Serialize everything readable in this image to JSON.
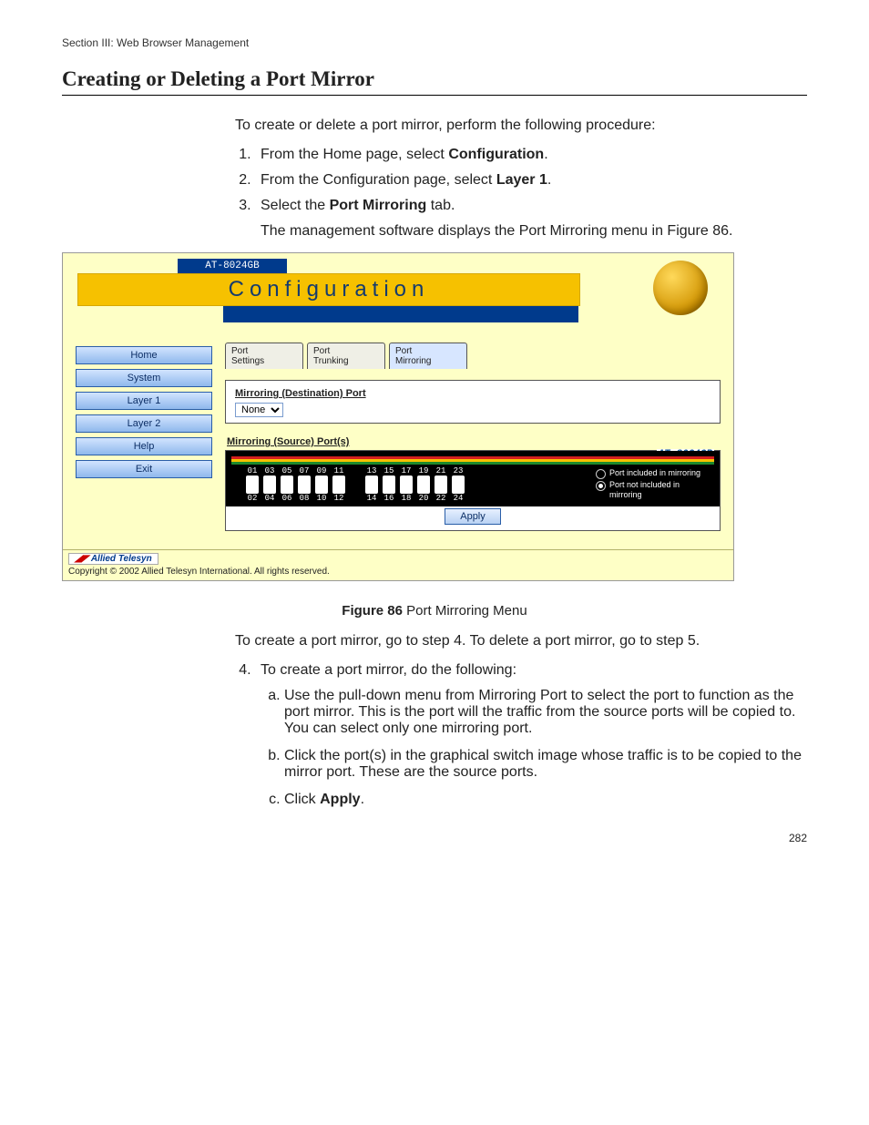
{
  "section_header": "Section III: Web Browser Management",
  "page_title": "Creating or Deleting a Port Mirror",
  "intro": "To create or delete a port mirror, perform the following procedure:",
  "steps": {
    "s1_a": "From the Home page, select ",
    "s1_b": "Configuration",
    "s1_c": ".",
    "s2_a": "From the Configuration page, select ",
    "s2_b": "Layer 1",
    "s2_c": ".",
    "s3_a": "Select the ",
    "s3_b": "Port Mirroring",
    "s3_c": " tab.",
    "s3_note": "The management software displays the Port Mirroring menu in Figure 86."
  },
  "ui": {
    "device": "AT-8024GB",
    "title": "Configuration",
    "nav": [
      "Home",
      "System",
      "Layer 1",
      "Layer 2",
      "Help",
      "Exit"
    ],
    "tabs": {
      "settings": "Port\nSettings",
      "trunking": "Port\nTrunking",
      "mirroring": "Port\nMirroring"
    },
    "dest_label": "Mirroring (Destination) Port",
    "dest_value": "None",
    "src_label": "Mirroring (Source) Port(s)",
    "model": "AT-8024GB",
    "ports_top": [
      "01",
      "03",
      "05",
      "07",
      "09",
      "11",
      "",
      "13",
      "15",
      "17",
      "19",
      "21",
      "23"
    ],
    "ports_bottom": [
      "02",
      "04",
      "06",
      "08",
      "10",
      "12",
      "",
      "14",
      "16",
      "18",
      "20",
      "22",
      "24"
    ],
    "legend": {
      "inc": "Port included in mirroring",
      "exc": "Port not included in mirroring"
    },
    "apply": "Apply",
    "footer_logo": "Allied Telesyn",
    "footer_copy": "Copyright © 2002 Allied Telesyn International. All rights reserved."
  },
  "fig_caption_bold": "Figure 86",
  "fig_caption_rest": "  Port Mirroring Menu",
  "after_fig": "To create a port mirror, go to step 4. To delete a port mirror, go to step 5.",
  "step4_lead": "To create a port mirror, do the following:",
  "step4": {
    "a": "Use the pull-down menu from Mirroring Port to select the port to function as the port mirror. This is the port will the traffic from the source ports will be copied to. You can select only one mirroring port.",
    "b": "Click the port(s) in the graphical switch image whose traffic is to be copied to the mirror port. These are the source ports.",
    "c_a": "Click ",
    "c_b": "Apply",
    "c_c": "."
  },
  "page_number": "282"
}
